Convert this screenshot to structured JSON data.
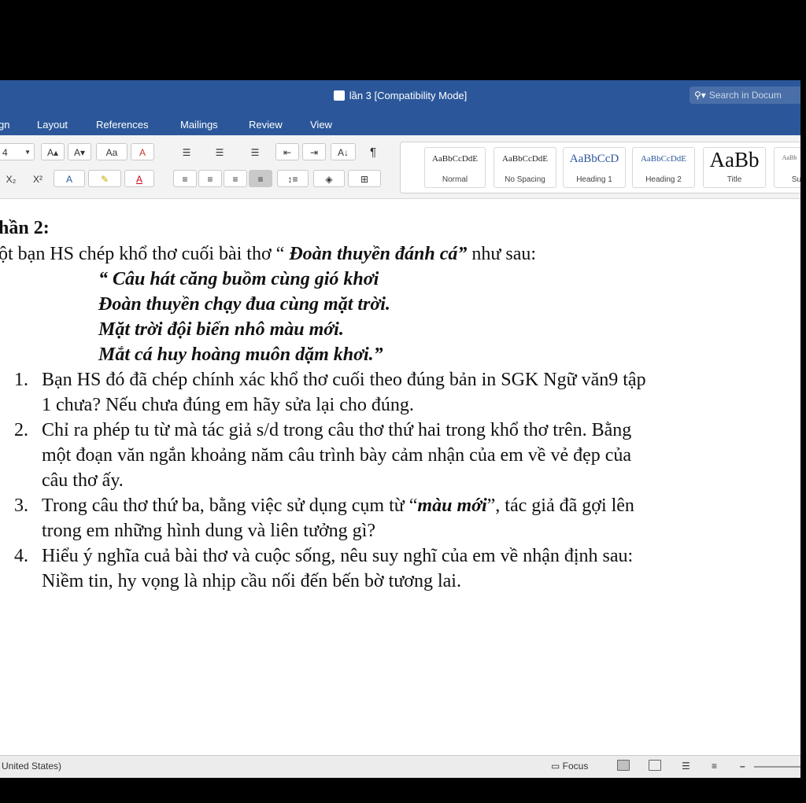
{
  "window": {
    "title": "lần 3 [Compatibility Mode]",
    "search_placeholder": "Search in Docum"
  },
  "tabs": [
    {
      "label": "gn"
    },
    {
      "label": "Layout"
    },
    {
      "label": "References"
    },
    {
      "label": "Mailings"
    },
    {
      "label": "Review"
    },
    {
      "label": "View"
    }
  ],
  "ribbon": {
    "font_size": "4",
    "grow_font": "A▴",
    "shrink_font": "A▾",
    "change_case": "Aa",
    "clear_format": "A",
    "subscript": "X₂",
    "superscript": "X²",
    "text_effects": "A",
    "highlight": "✎",
    "font_color": "A",
    "bullets": "☰",
    "numbering": "☰",
    "multilevel": "☰",
    "outdent": "⇤",
    "indent": "⇥",
    "sort": "A↓",
    "pilcrow": "¶",
    "align_left": "≡",
    "align_center": "≡",
    "align_right": "≡",
    "justify": "≡",
    "line_spacing": "↕≡",
    "shading": "◈",
    "borders": "⊞"
  },
  "styles": [
    {
      "sample": "AaBbCcDdE",
      "name": "Normal"
    },
    {
      "sample": "AaBbCcDdE",
      "name": "No Spacing"
    },
    {
      "sample": "AaBbCcD",
      "name": "Heading 1"
    },
    {
      "sample": "AaBbCcDdE",
      "name": "Heading 2"
    },
    {
      "sample": "AaBb",
      "name": "Title"
    },
    {
      "sample": "AaBb",
      "name": "Su"
    }
  ],
  "doc": {
    "heading": "hần 2:",
    "intro_pre": "ột bạn HS chép khổ thơ cuối bài thơ “ ",
    "intro_title": "Đoàn thuyền đánh cá”",
    "intro_post": " như sau:",
    "poem": [
      "“ Câu hát căng buồm cùng gió khơi",
      "Đoàn thuyền chạy đua cùng mặt trời.",
      "Mặt trời đội biển nhô màu mới.",
      "Mắt cá huy hoàng muôn dặm khơi.”"
    ],
    "q1_num": "1.",
    "q1_line1": "Bạn HS đó đã chép chính xác khổ thơ cuối theo đúng bản in SGK Ngữ văn9 tập",
    "q1_line2": "1 chưa? Nếu chưa đúng em hãy sửa lại cho đúng.",
    "q2_num": "2.",
    "q2_line1": "Chỉ ra phép tu từ mà tác giả s/d trong câu thơ thứ hai trong khổ thơ trên. Bằng",
    "q2_line2": "một đoạn văn ngắn khoảng năm câu trình bày cảm nhận của em về vẻ đẹp của",
    "q2_line3": "câu thơ ấy.",
    "q3_num": "3.",
    "q3_pre": "Trong câu thơ thứ ba, bằng việc sử dụng cụm từ “",
    "q3_em": "màu mới",
    "q3_post": "”, tác giả đã gợi lên",
    "q3_line2": "trong em những hình dung và liên tưởng gì?",
    "q4_num": "4.",
    "q4_line1": "Hiểu ý nghĩa cuả bài thơ và cuộc sống, nêu suy nghĩ của em về nhận định sau:",
    "q4_line2": "Niềm tin, hy vọng là nhịp cầu nối đến bến bờ tương lai."
  },
  "statusbar": {
    "language": "United States)",
    "focus": "Focus",
    "zoom_out": "–"
  }
}
